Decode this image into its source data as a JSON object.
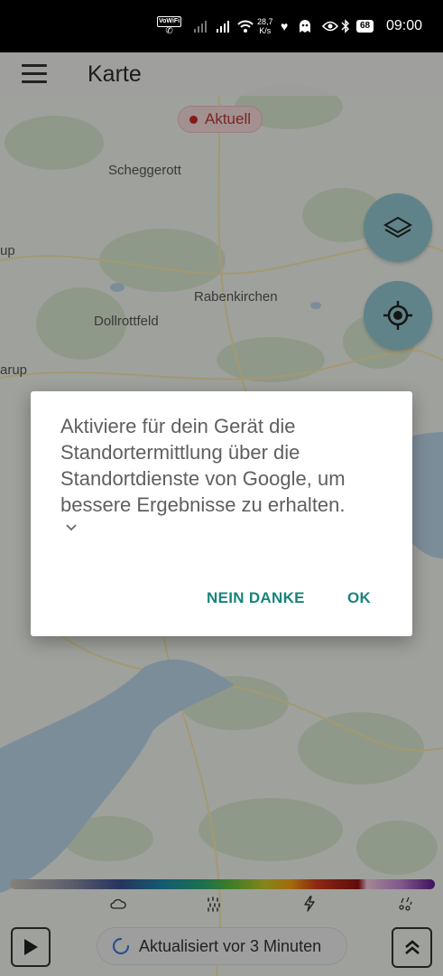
{
  "status_bar": {
    "wifi_calling": "VoWiFi",
    "net_speed_value": "28,7",
    "net_speed_unit": "K/s",
    "battery": "68",
    "time": "09:00"
  },
  "app_bar": {
    "title": "Karte"
  },
  "map": {
    "current_chip": "Aktuell",
    "places": {
      "scheggerott": "Scheggerott",
      "rabenkirchen": "Rabenkirchen",
      "dollrottfeld": "Dollrottfeld",
      "left_top_partial": "up",
      "left_mid_partial": "arup"
    }
  },
  "dialog": {
    "message": "Aktiviere für dein Gerät die Standortermittlung über die Standortdienste von Google, um bessere Ergebnisse zu erhalten.",
    "negative_label": "NEIN DANKE",
    "positive_label": "OK"
  },
  "bottom": {
    "update_text": "Aktualisiert vor 3 Minuten",
    "legend_icons": [
      "cloud-icon",
      "rain-icon",
      "lightning-icon",
      "hail-icon"
    ]
  },
  "colors": {
    "accent": "#17847c",
    "fab": "#8fc3cc",
    "chip_dot": "#c62828"
  }
}
